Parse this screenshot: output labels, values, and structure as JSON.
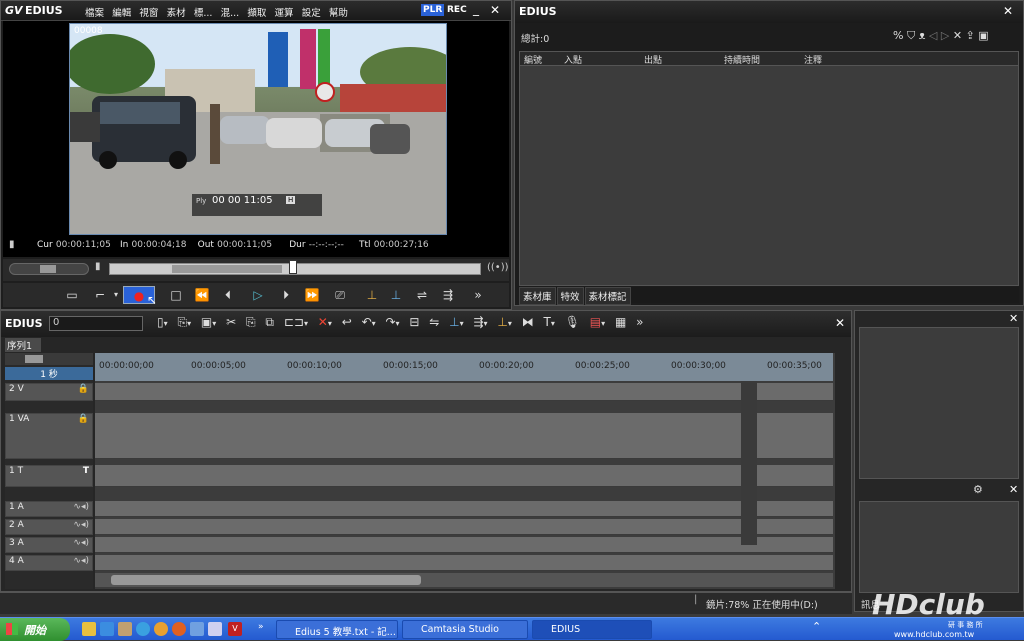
{
  "player": {
    "app_name": "EDIUS",
    "menu": [
      "檔案",
      "編輯",
      "視窗",
      "素材",
      "標...",
      "混...",
      "擷取",
      "運算",
      "設定",
      "幫助"
    ],
    "plr_label": "PLR",
    "rec_label": "REC",
    "frame_counter": "00008",
    "overlay_tc_prefix": "Ply",
    "overlay_tc": "00 00 11:05",
    "overlay_tc_badge": "H",
    "cur_label": "Cur",
    "cur_value": "00:00:11;05",
    "in_label": "In",
    "in_value": "00:00:04;18",
    "out_label": "Out",
    "out_value": "00:00:11;05",
    "dur_label": "Dur",
    "dur_value": "--:--:--;--",
    "ttl_label": "Ttl",
    "ttl_value": "00:00:27;16",
    "scrub_position": 0.494
  },
  "bin": {
    "title": "EDIUS",
    "total_label": "總計:0",
    "columns": [
      "編號",
      "入點",
      "出點",
      "持續時間",
      "注釋"
    ],
    "tabs": [
      "素材庫",
      "特效",
      "素材標記"
    ]
  },
  "timeline": {
    "app_name": "EDIUS",
    "project_field": "0",
    "sequence_tab": "序列1",
    "scale_label": "1 秒",
    "ruler_ticks": [
      "00:00:00;00",
      "00:00:05;00",
      "00:00:10;00",
      "00:00:15;00",
      "00:00:20;00",
      "00:00:25;00",
      "00:00:30;00",
      "00:00:35;00"
    ],
    "tracks": [
      {
        "label": "2 V"
      },
      {
        "label": "1 VA"
      },
      {
        "label": "1 T"
      },
      {
        "label": "1 A"
      },
      {
        "label": "2 A"
      },
      {
        "label": "3 A"
      },
      {
        "label": "4 A"
      }
    ]
  },
  "right_panel": {
    "bottom_label": "訊息"
  },
  "status": {
    "text": "鏡片:78% 正在使用中(D:)"
  },
  "taskbar": {
    "start_label": "開始",
    "buttons": [
      "Edius 5 教學.txt - 記...",
      "Camtasia Studio",
      "EDIUS"
    ],
    "watermark": "HDclub",
    "watermark_sub": "研 事 務 所",
    "watermark_url": "www.hdclub.com.tw"
  },
  "colors": {
    "accent_blue": "#2a62d8",
    "rec_button": "#d02020",
    "ruler": "#7b8a97",
    "track": "#6b6b6b"
  }
}
